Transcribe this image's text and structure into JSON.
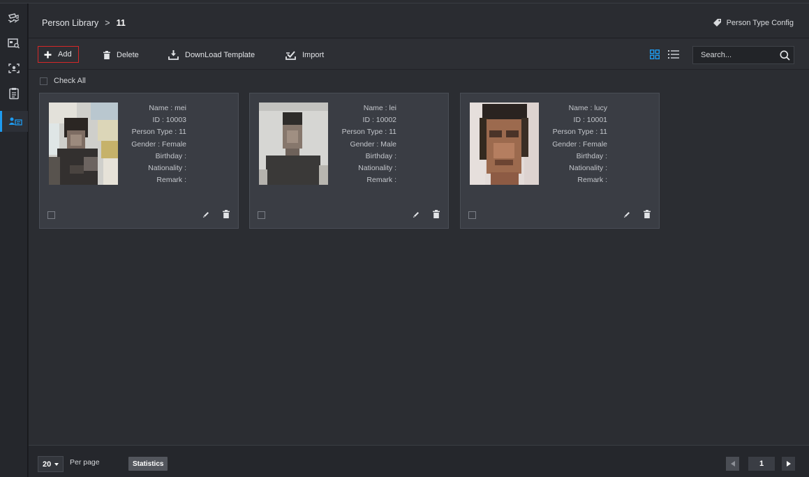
{
  "sidebar": {
    "items": [
      {
        "icon": "camera-monitor-icon"
      },
      {
        "icon": "face-search-icon"
      },
      {
        "icon": "face-capture-icon"
      },
      {
        "icon": "clipboard-icon"
      },
      {
        "icon": "person-library-icon",
        "active": true
      }
    ]
  },
  "header": {
    "breadcrumb_root": "Person Library",
    "breadcrumb_sep": ">",
    "breadcrumb_current": "11",
    "person_type_config": "Person Type Config"
  },
  "toolbar": {
    "add_label": "Add",
    "delete_label": "Delete",
    "download_template_label": "DownLoad Template",
    "import_label": "Import",
    "search_placeholder": "Search..."
  },
  "check_all_label": "Check All",
  "people": [
    {
      "name": "Name : mei",
      "id": "ID : 10003",
      "type": "Person Type : 11",
      "gender": "Gender : Female",
      "birthday": "Birthday :",
      "nationality": "Nationality :",
      "remark": "Remark :"
    },
    {
      "name": "Name : lei",
      "id": "ID : 10002",
      "type": "Person Type : 11",
      "gender": "Gender : Male",
      "birthday": "Birthday :",
      "nationality": "Nationality :",
      "remark": "Remark :"
    },
    {
      "name": "Name : lucy",
      "id": "ID : 10001",
      "type": "Person Type : 11",
      "gender": "Gender : Female",
      "birthday": "Birthday :",
      "nationality": "Nationality :",
      "remark": "Remark :"
    }
  ],
  "footer": {
    "per_page_value": "20",
    "per_page_label": "Per page",
    "statistics_label": "Statistics",
    "current_page": "1"
  },
  "colors": {
    "accent": "#1e9bf0",
    "add_highlight": "#d62828",
    "background": "#2b2d32"
  }
}
